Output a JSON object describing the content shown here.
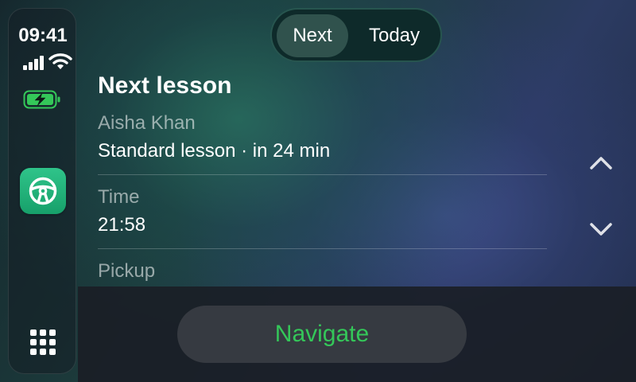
{
  "status": {
    "time": "09:41",
    "battery": {
      "charging": true,
      "color": "#34c759"
    }
  },
  "sidebar": {
    "app_icon": "steering-wheel-icon",
    "app_icon_color": "#22b276",
    "launcher_icon": "grid-icon"
  },
  "segmented": {
    "options": [
      "Next",
      "Today"
    ],
    "selected": "Next"
  },
  "lesson": {
    "heading": "Next lesson",
    "student": "Aisha Khan",
    "summary": "Standard lesson · in 24 min",
    "time_label": "Time",
    "time_value": "21:58",
    "pickup_label": "Pickup"
  },
  "scroll": {
    "up_icon": "chevron-up-icon",
    "down_icon": "chevron-down-icon"
  },
  "actions": {
    "navigate_label": "Navigate",
    "navigate_color": "#34c759"
  }
}
